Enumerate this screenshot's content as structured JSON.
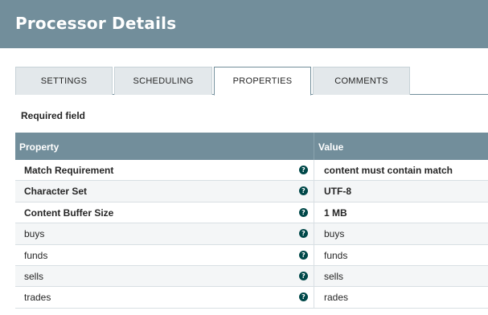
{
  "header": {
    "title": "Processor Details"
  },
  "tabs": [
    {
      "label": "SETTINGS",
      "active": false
    },
    {
      "label": "SCHEDULING",
      "active": false
    },
    {
      "label": "PROPERTIES",
      "active": true
    },
    {
      "label": "COMMENTS",
      "active": false
    }
  ],
  "required_note": "Required field",
  "table": {
    "columns": {
      "property": "Property",
      "value": "Value"
    },
    "rows": [
      {
        "property": "Match Requirement",
        "value": "content must contain match",
        "required": true
      },
      {
        "property": "Character Set",
        "value": "UTF-8",
        "required": true
      },
      {
        "property": "Content Buffer Size",
        "value": "1 MB",
        "required": true
      },
      {
        "property": "buys",
        "value": "buys",
        "required": false
      },
      {
        "property": "funds",
        "value": "funds",
        "required": false
      },
      {
        "property": "sells",
        "value": "sells",
        "required": false
      },
      {
        "property": "trades",
        "value": "rades",
        "required": false
      }
    ],
    "help_icon_glyph": "?"
  },
  "colors": {
    "header_bg": "#728e9b",
    "help_icon": "#004849",
    "tab_bg": "#e3e8eb"
  }
}
